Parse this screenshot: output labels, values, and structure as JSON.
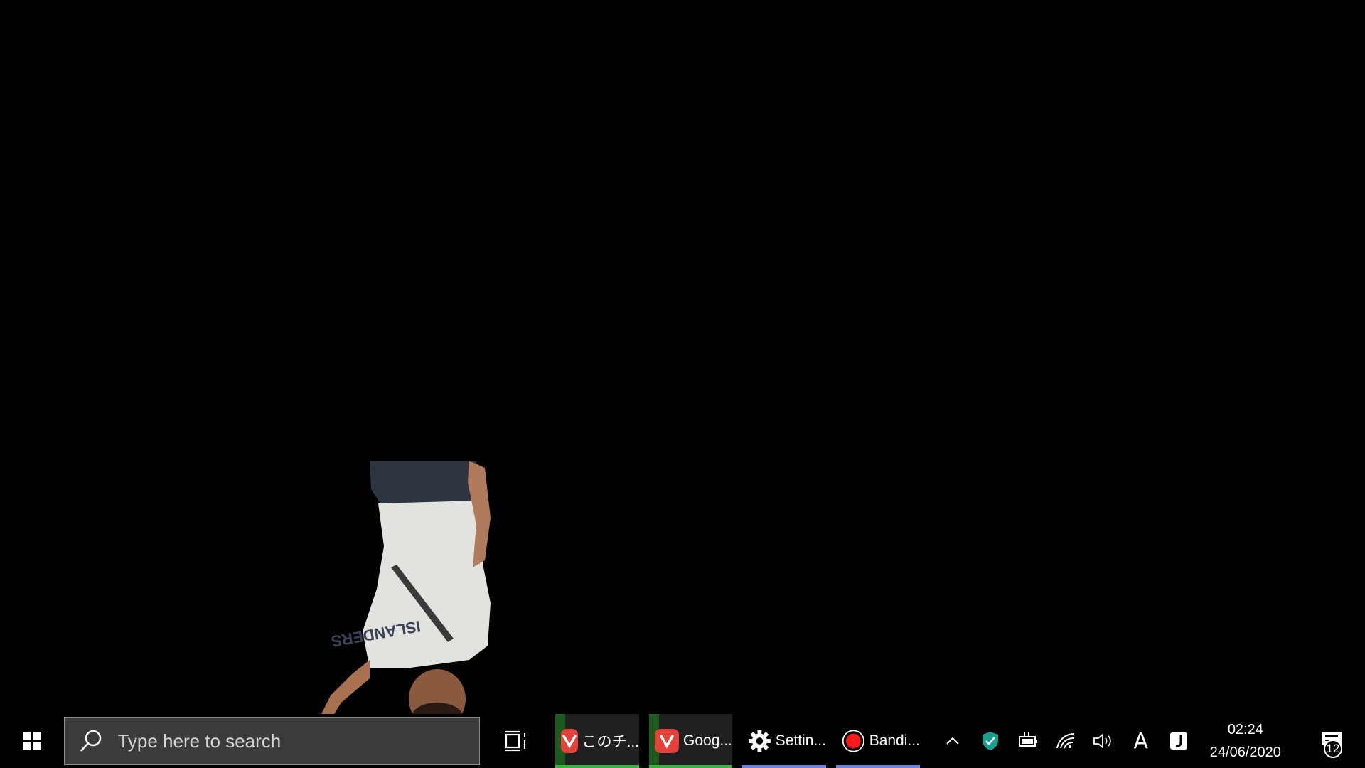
{
  "search": {
    "placeholder": "Type here to search"
  },
  "taskbar": {
    "apps": [
      {
        "label": "このチ...",
        "icon": "vivaldi-icon",
        "underline": "#3cb043"
      },
      {
        "label": "Goog...",
        "icon": "vivaldi-icon",
        "underline": "#3cb043"
      },
      {
        "label": "Settin...",
        "icon": "gear-icon",
        "underline": "#6b86d8"
      },
      {
        "label": "Bandi...",
        "icon": "record-icon",
        "underline": "#6b86d8"
      }
    ]
  },
  "tray": {
    "icons": [
      "chevron-up-icon",
      "shield-check-icon",
      "battery-plug-icon",
      "wifi-icon",
      "volume-icon",
      "ime-letter-icon",
      "japanese-input-icon"
    ],
    "ime_letter": "A"
  },
  "clock": {
    "time": "02:24",
    "date": "24/06/2020"
  },
  "notifications": {
    "count": "12"
  },
  "colors": {
    "taskbar_bg": "#000000",
    "search_bg": "#3b3b3b",
    "vivaldi_red": "#e5413b",
    "record_red": "#ff1a1a",
    "shield_teal": "#1a9e8f",
    "accent_green": "#3cb043",
    "accent_blue": "#6b86d8"
  }
}
